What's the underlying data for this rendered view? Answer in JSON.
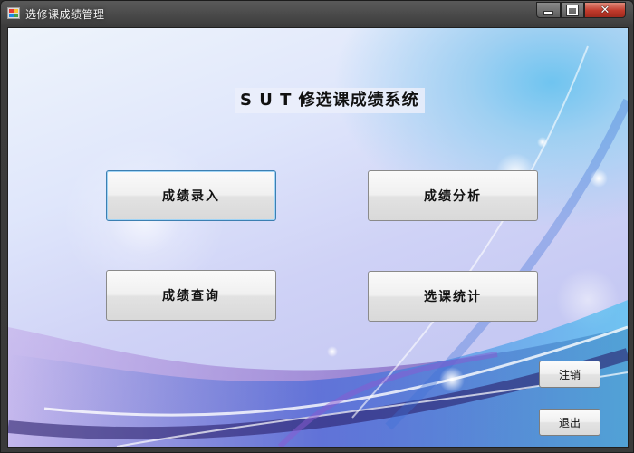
{
  "window": {
    "title": "选修课成绩管理",
    "controls": {
      "minimize": "minimize",
      "maximize": "maximize",
      "close": "close"
    }
  },
  "main": {
    "system_title": "S U T 修选课成绩系统",
    "buttons": {
      "score_entry": "成绩录入",
      "score_analysis": "成绩分析",
      "score_query": "成绩查询",
      "course_stats": "选课统计"
    },
    "logout": "注销",
    "exit": "退出"
  },
  "colors": {
    "title_bar": "#3c3c3c",
    "close_button": "#c0392b",
    "focus_border": "#3c7fb1"
  },
  "icons": {
    "app": "app-icon",
    "minimize": "minimize-icon",
    "maximize": "maximize-icon",
    "close": "close-icon"
  }
}
